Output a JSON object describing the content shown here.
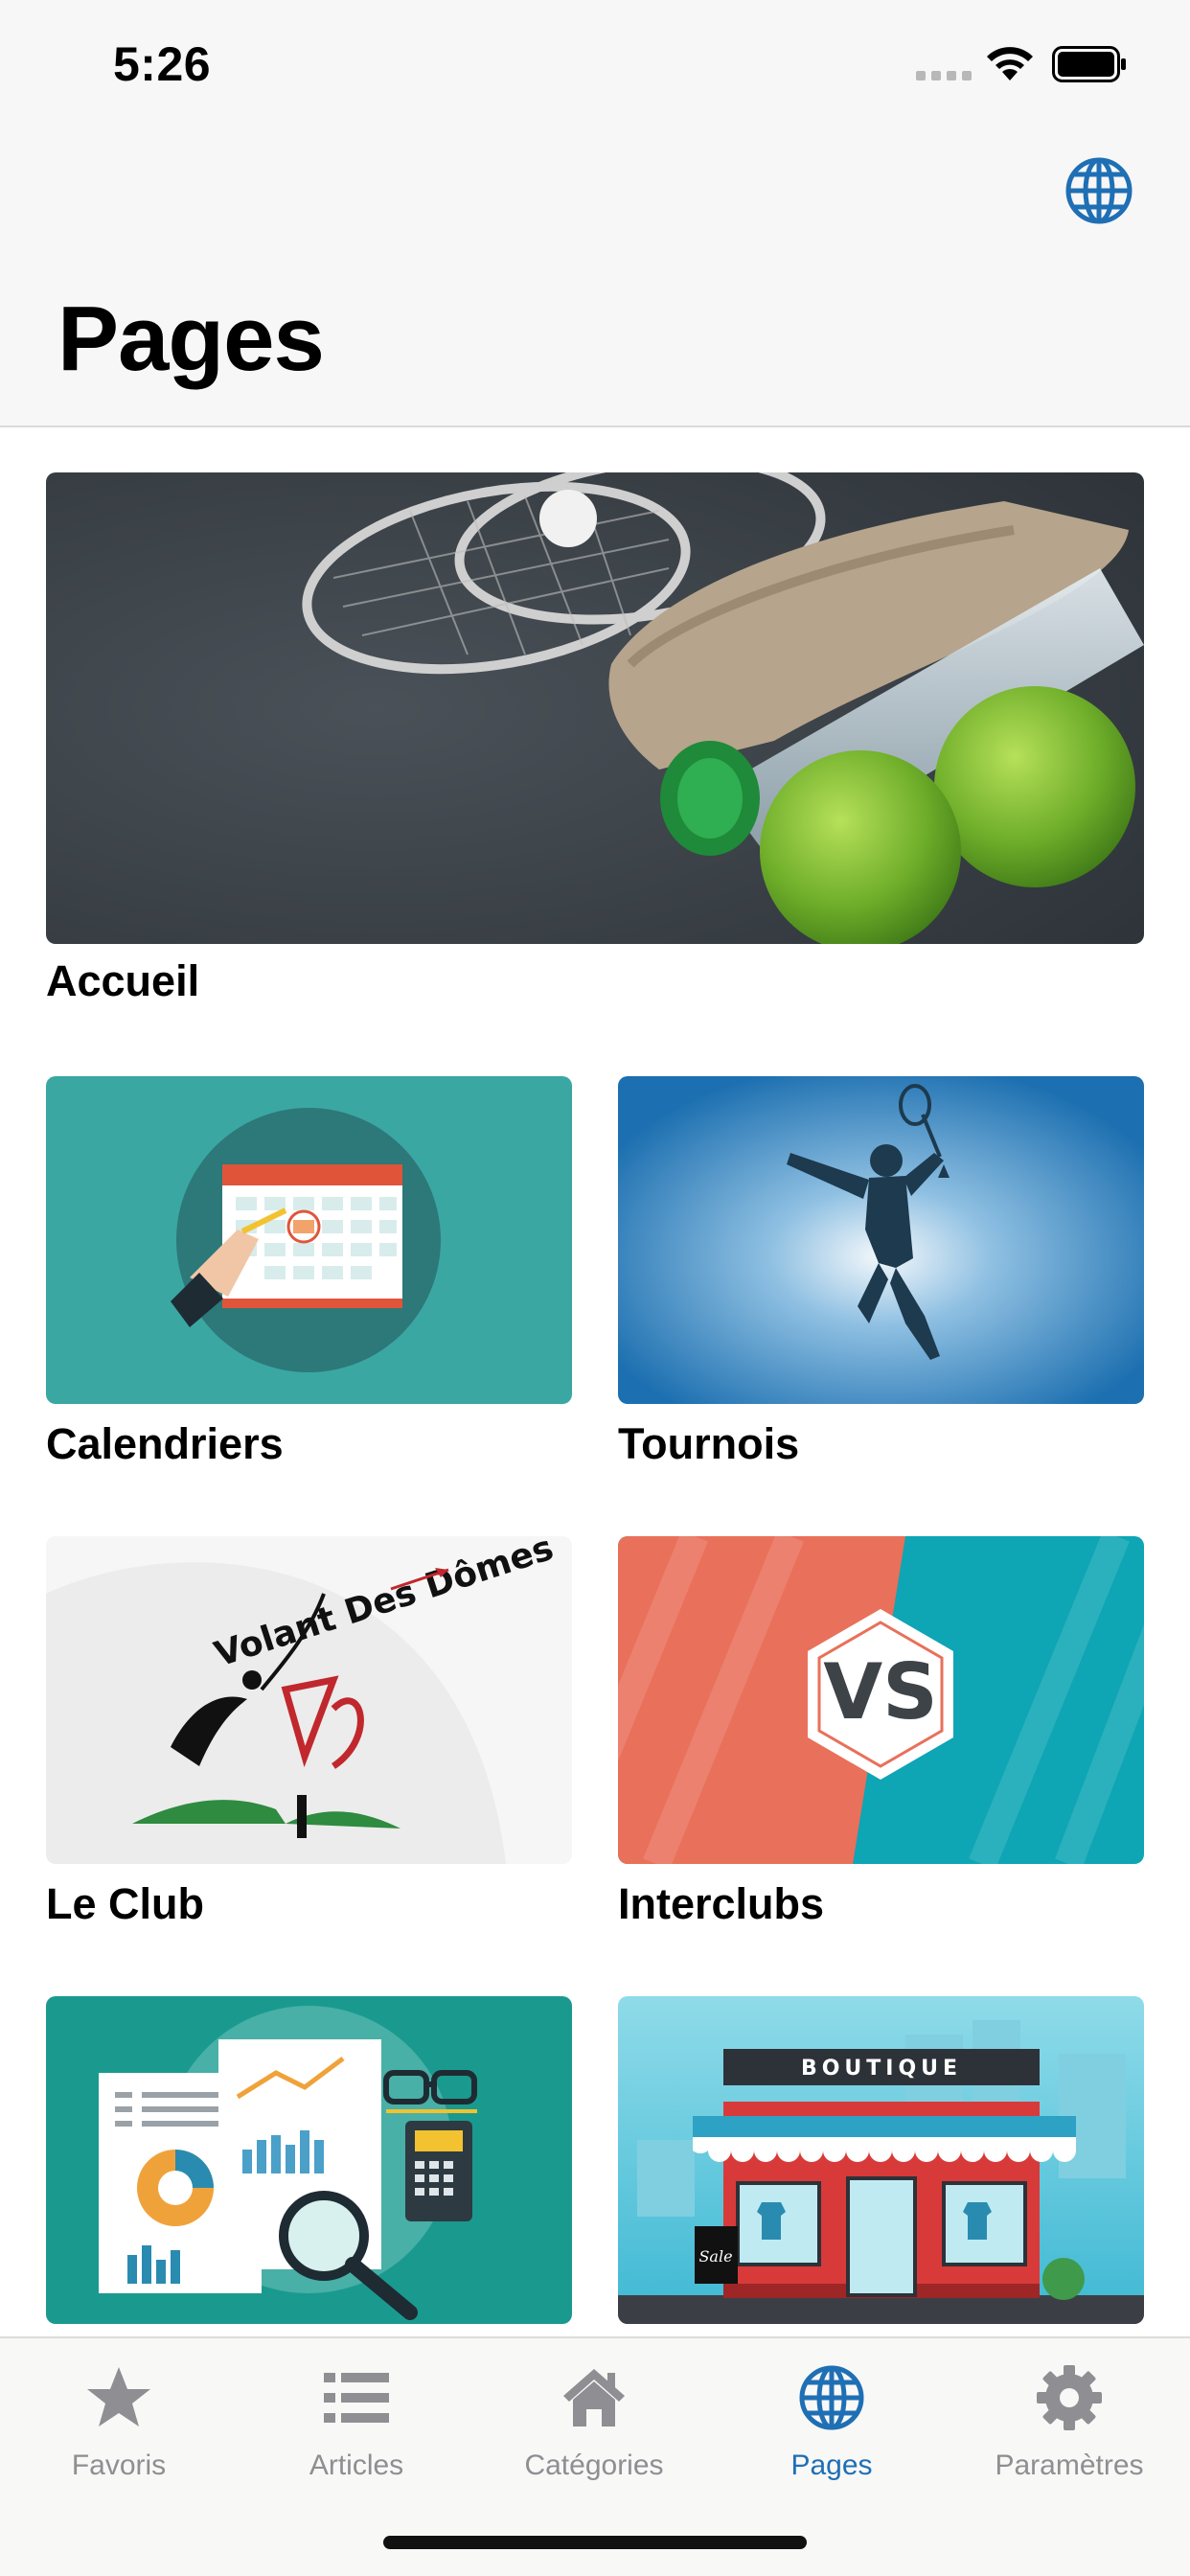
{
  "status_bar": {
    "time": "5:26"
  },
  "header": {
    "title": "Pages",
    "globe_icon": "globe-icon"
  },
  "cards": [
    {
      "label": "Accueil",
      "image": "badminton-racket-towel-bottle-apples"
    },
    {
      "label": "Calendriers",
      "image": "calendar-illustration"
    },
    {
      "label": "Tournois",
      "image": "badminton-player-silhouette"
    },
    {
      "label": "Le Club",
      "image": "volant-des-domes-logo"
    },
    {
      "label": "Interclubs",
      "image": "vs-badge"
    },
    {
      "label": "",
      "image": "reports-magnifier-illustration"
    },
    {
      "label": "",
      "image": "boutique-shop-illustration"
    }
  ],
  "logo_text": {
    "club": "Volant Des Dômes",
    "vs": "VS",
    "shop_sign": "BOUTIQUE",
    "sale_tag": "Sale"
  },
  "tabs": [
    {
      "label": "Favoris",
      "icon": "star-icon",
      "active": false
    },
    {
      "label": "Articles",
      "icon": "list-icon",
      "active": false
    },
    {
      "label": "Catégories",
      "icon": "home-icon",
      "active": false
    },
    {
      "label": "Pages",
      "icon": "globe-icon",
      "active": true
    },
    {
      "label": "Paramètres",
      "icon": "gear-icon",
      "active": false
    }
  ],
  "colors": {
    "accent": "#1f6fb5",
    "inactive": "#8e8e93",
    "teal": "#3aa7a3",
    "blue": "#1c6fb0",
    "coral": "#e9705a",
    "cyan": "#0ea5b4"
  }
}
